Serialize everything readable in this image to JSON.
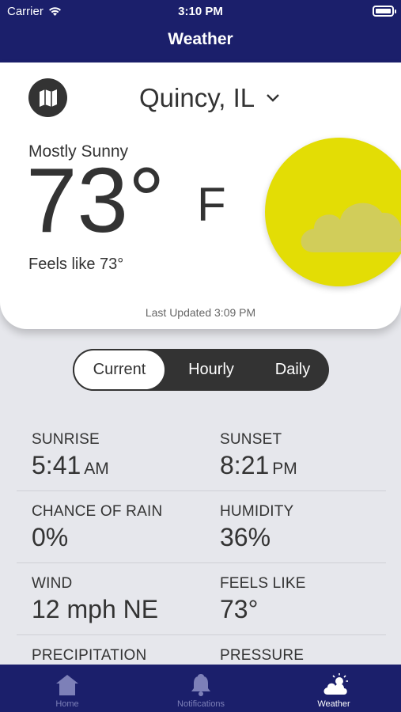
{
  "status_bar": {
    "carrier": "Carrier",
    "time": "3:10 PM"
  },
  "nav": {
    "title": "Weather"
  },
  "card": {
    "location": "Quincy, IL",
    "condition": "Mostly Sunny",
    "temperature": "73°",
    "unit": "F",
    "feels_like": "Feels like 73°",
    "last_updated": "Last Updated 3:09 PM",
    "icon": "partly-sunny-icon",
    "sun_color": "#e3dd05"
  },
  "segments": [
    {
      "label": "Current",
      "active": true
    },
    {
      "label": "Hourly",
      "active": false
    },
    {
      "label": "Daily",
      "active": false
    }
  ],
  "details": [
    {
      "left": {
        "label": "SUNRISE",
        "value": "5:41",
        "suffix": "AM"
      },
      "right": {
        "label": "SUNSET",
        "value": "8:21",
        "suffix": "PM"
      }
    },
    {
      "left": {
        "label": "CHANCE OF RAIN",
        "value": "0%"
      },
      "right": {
        "label": "HUMIDITY",
        "value": "36%"
      }
    },
    {
      "left": {
        "label": "WIND",
        "value": "12 mph NE"
      },
      "right": {
        "label": "FEELS LIKE",
        "value": "73°"
      }
    },
    {
      "left": {
        "label": "PRECIPITATION",
        "value": ""
      },
      "right": {
        "label": "PRESSURE",
        "value": ""
      }
    }
  ],
  "tabs": [
    {
      "label": "Home",
      "icon": "house-icon",
      "active": false
    },
    {
      "label": "Notifications",
      "icon": "bell-icon",
      "active": false
    },
    {
      "label": "Weather",
      "icon": "weather-cloud-sun-icon",
      "active": true
    }
  ],
  "colors": {
    "header": "#1b1f6b",
    "background": "#e6e7ec",
    "accent_yellow": "#e3dd05"
  }
}
